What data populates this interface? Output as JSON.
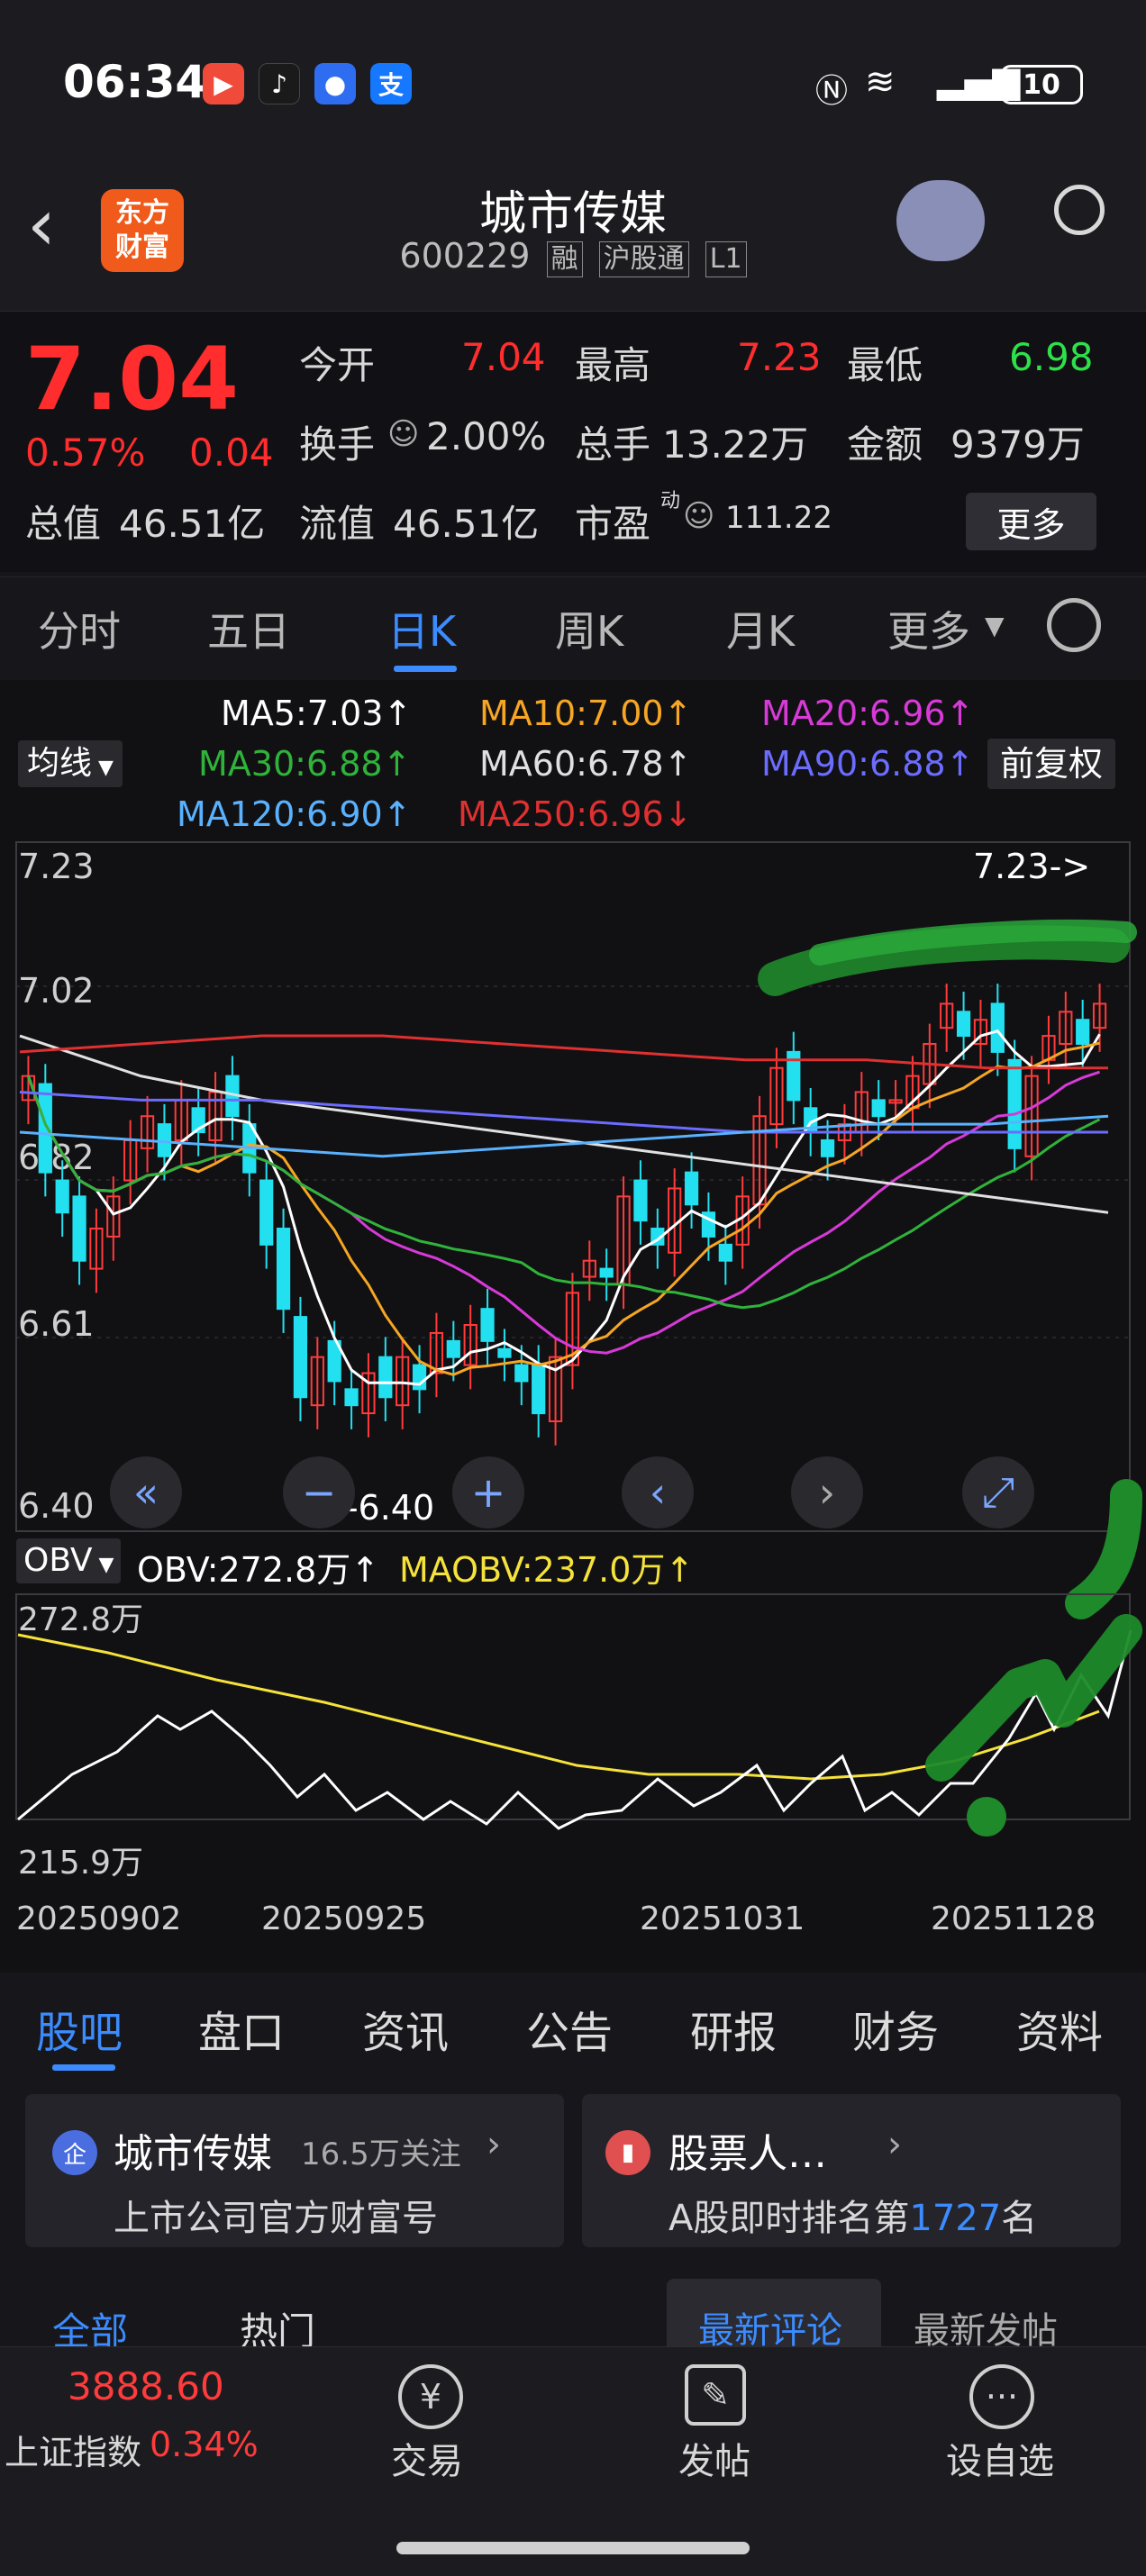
{
  "status_bar": {
    "time": "06:34",
    "battery": "10"
  },
  "header": {
    "title": "城市传媒",
    "code": "600229",
    "tags": [
      "融",
      "沪股通",
      "L1"
    ]
  },
  "quote": {
    "price": "7.04",
    "pct": "0.57%",
    "change": "0.04",
    "open_label": "今开",
    "open": "7.04",
    "high_label": "最高",
    "high": "7.23",
    "low_label": "最低",
    "low": "6.98",
    "turnover_label": "换手",
    "turnover": "2.00%",
    "volume_label": "总手",
    "volume": "13.22万",
    "amount_label": "金额",
    "amount": "9379万",
    "mcap_label": "总值",
    "mcap": "46.51亿",
    "float_label": "流值",
    "float": "46.51亿",
    "pe_label": "市盈",
    "pe_sup": "动",
    "pe": "111.22",
    "more": "更多"
  },
  "tabs": [
    "分时",
    "五日",
    "日K",
    "周K",
    "月K",
    "更多"
  ],
  "indicators": {
    "ma_label": "均线",
    "fq": "前复权",
    "ma5": "MA5:7.03↑",
    "ma10": "MA10:7.00↑",
    "ma20": "MA20:6.96↑",
    "ma30": "MA30:6.88↑",
    "ma60": "MA60:6.78↑",
    "ma90": "MA90:6.88↑",
    "ma120": "MA120:6.90↑",
    "ma250": "MA250:6.96↓"
  },
  "colors": {
    "ma5": "#ffffff",
    "ma10": "#f6a623",
    "ma20": "#d83ad8",
    "ma30": "#2fb33a",
    "ma60": "#e0e0e0",
    "ma90": "#6c6cff",
    "ma120": "#5ab2ff",
    "ma250": "#e03030",
    "up": "#ff3b3b",
    "down": "#22e0f0",
    "obv": "#ffffff",
    "maobv": "#f5e23a"
  },
  "chart_data": {
    "type": "candlestick",
    "ylim": [
      6.4,
      7.23
    ],
    "yticks": [
      "7.23",
      "7.02",
      "6.82",
      "6.61",
      "6.40"
    ],
    "high_marker": "7.23->",
    "low_marker": "<-6.40",
    "xticks": [
      "20250902",
      "20250925",
      "20251031",
      "20251128"
    ],
    "closes": [
      6.95,
      6.83,
      6.78,
      6.72,
      6.76,
      6.8,
      6.87,
      6.9,
      6.85,
      6.92,
      6.88,
      6.93,
      6.9,
      6.83,
      6.74,
      6.66,
      6.55,
      6.6,
      6.57,
      6.54,
      6.58,
      6.55,
      6.6,
      6.56,
      6.63,
      6.6,
      6.64,
      6.62,
      6.6,
      6.57,
      6.53,
      6.6,
      6.68,
      6.72,
      6.7,
      6.8,
      6.77,
      6.74,
      6.81,
      6.79,
      6.75,
      6.72,
      6.8,
      6.9,
      6.96,
      6.92,
      6.88,
      6.85,
      6.89,
      6.93,
      6.9,
      6.92,
      6.95,
      6.99,
      7.04,
      7.0,
      7.02,
      6.98,
      6.86,
      6.95,
      7.0,
      7.03,
      6.99,
      7.04
    ]
  },
  "obv": {
    "label": "OBV",
    "value": "OBV:272.8万↑",
    "ma": "MAOBV:237.0万↑",
    "top": "272.8万",
    "bottom": "215.9万"
  },
  "bottom_tabs": [
    "股吧",
    "盘口",
    "资讯",
    "公告",
    "研报",
    "财务",
    "资料"
  ],
  "cards": {
    "c1_name": "城市传媒",
    "c1_follow": "16.5万关注",
    "c1_sub": "上市公司官方财富号",
    "c2_name": "股票人…",
    "c2_sub_a": "A股即时排名第",
    "c2_rank": "1727",
    "c2_sub_b": "名"
  },
  "filters": {
    "all": "全部",
    "hot": "热门",
    "latest_comment": "最新评论",
    "latest_post": "最新发帖"
  },
  "footer": {
    "index_value": "3888.60",
    "index_name": "上证指数",
    "index_pct": "0.34%",
    "trade": "交易",
    "post": "发帖",
    "watch": "设自选"
  }
}
